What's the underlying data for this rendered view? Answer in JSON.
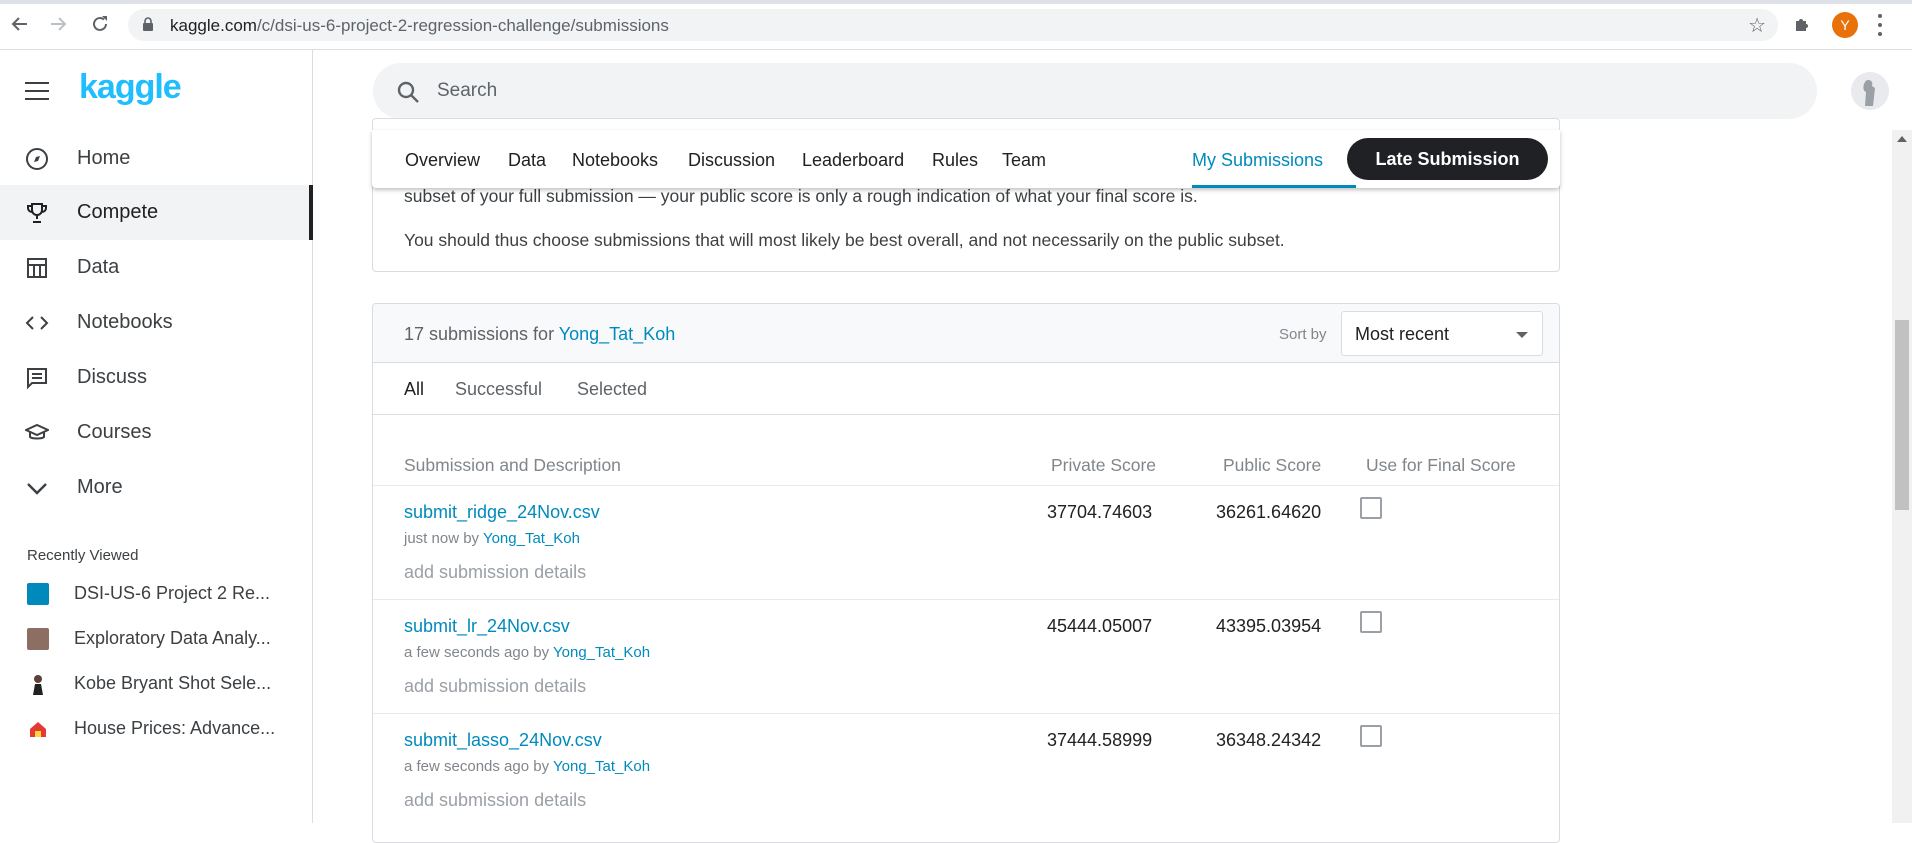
{
  "browser": {
    "url_host": "kaggle.com",
    "url_path": "/c/dsi-us-6-project-2-regression-challenge/submissions",
    "profile_initial": "Y"
  },
  "sidebar": {
    "logo": "kaggle",
    "items": [
      {
        "label": "Home",
        "icon": "compass-icon"
      },
      {
        "label": "Compete",
        "icon": "trophy-icon"
      },
      {
        "label": "Data",
        "icon": "table-icon"
      },
      {
        "label": "Notebooks",
        "icon": "code-icon"
      },
      {
        "label": "Discuss",
        "icon": "discussion-icon"
      },
      {
        "label": "Courses",
        "icon": "graduation-cap-icon"
      },
      {
        "label": "More",
        "icon": "chevron-down-icon"
      }
    ],
    "recent_title": "Recently Viewed",
    "recent": [
      {
        "label": "DSI-US-6 Project 2 Re...",
        "color": "#008abc"
      },
      {
        "label": "Exploratory Data Analy...",
        "color": "#8d6e63"
      },
      {
        "label": "Kobe Bryant Shot Sele...",
        "color": "#5d4037"
      },
      {
        "label": "House Prices: Advance...",
        "color": "#e53935"
      }
    ]
  },
  "search": {
    "placeholder": "Search"
  },
  "tabs": {
    "items": [
      "Overview",
      "Data",
      "Notebooks",
      "Discussion",
      "Leaderboard",
      "Rules",
      "Team"
    ],
    "my_submissions": "My Submissions",
    "late_submission": "Late Submission"
  },
  "info": {
    "line1": "subset of your full submission — your public score is only a rough indication of what your final score is.",
    "line2": "You should thus choose submissions that will most likely be best overall, and not necessarily on the public subset."
  },
  "submissions": {
    "count_text": "17 submissions for",
    "user": "Yong_Tat_Koh",
    "sort_label": "Sort by",
    "sort_value": "Most recent",
    "filters": [
      "All",
      "Successful",
      "Selected"
    ],
    "columns": {
      "description": "Submission and Description",
      "private": "Private Score",
      "public": "Public Score",
      "final": "Use for Final Score"
    },
    "rows": [
      {
        "file": "submit_ridge_24Nov.csv",
        "time": "just now by",
        "user": "Yong_Tat_Koh",
        "details": "add submission details",
        "private": "37704.74603",
        "public": "36261.64620"
      },
      {
        "file": "submit_lr_24Nov.csv",
        "time": "a few seconds ago by",
        "user": "Yong_Tat_Koh",
        "details": "add submission details",
        "private": "45444.05007",
        "public": "43395.03954"
      },
      {
        "file": "submit_lasso_24Nov.csv",
        "time": "a few seconds ago by",
        "user": "Yong_Tat_Koh",
        "details": "add submission details",
        "private": "37444.58999",
        "public": "36348.24342"
      }
    ]
  },
  "colors": {
    "accent": "#008abc",
    "kaggle_blue": "#20beff",
    "dark": "#202124"
  }
}
